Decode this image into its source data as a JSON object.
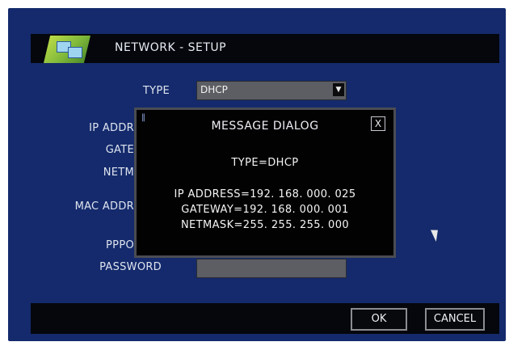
{
  "title": "NETWORK  -  SETUP",
  "form": {
    "type_label": "TYPE",
    "type_value": "DHCP",
    "ip_label": "IP  ADDR",
    "gateway_label": "GATE",
    "netmask_label": "NETM",
    "mac_label": "MAC  ADDR",
    "pppoe_label": "PPPO",
    "password_label": "PASSWORD"
  },
  "dialog": {
    "title": "MESSAGE  DIALOG",
    "close_label": "X",
    "type_line": "TYPE=DHCP",
    "ip_line": "IP  ADDRESS=192. 168. 000. 025",
    "gateway_line": "GATEWAY=192. 168. 000. 001",
    "netmask_line": "NETMASK=255. 255. 255. 000"
  },
  "buttons": {
    "ok": "OK",
    "cancel": "CANCEL"
  },
  "icons": {
    "logo": "network-setup-icon",
    "dropdown": "dropdown-arrow-icon",
    "cursor": "mouse-pointer-icon"
  }
}
